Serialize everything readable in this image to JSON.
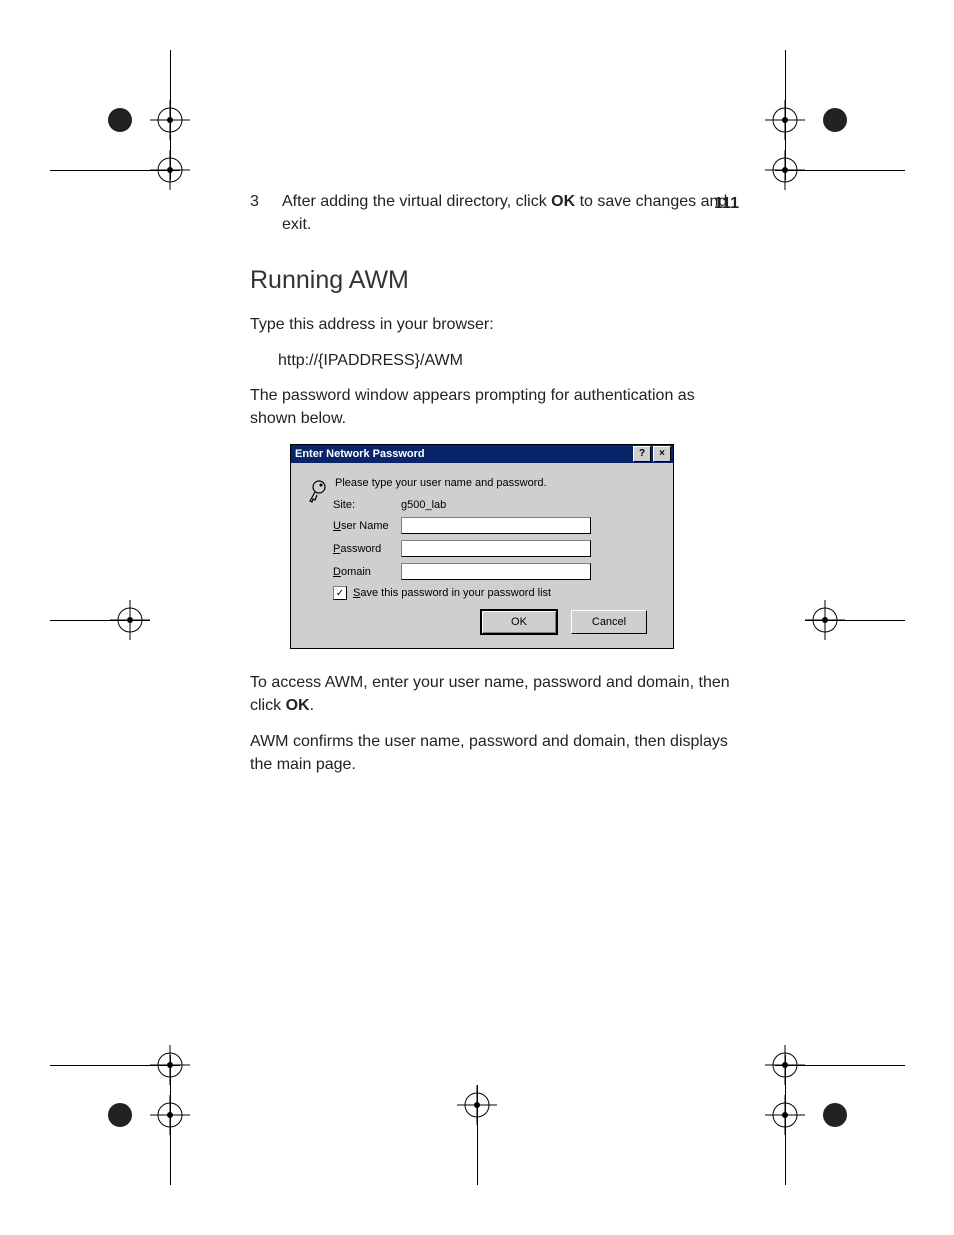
{
  "page_number": "111",
  "step": {
    "num": "3",
    "text_before_bold": "After adding the virtual directory, click ",
    "bold": "OK",
    "text_after_bold": " to save changes and exit."
  },
  "heading": "Running AWM",
  "p1": "Type this address in your browser:",
  "url": "http://{IPADDRESS}/AWM",
  "p2": "The password window appears prompting for authentication as shown below.",
  "dialog": {
    "title": "Enter Network Password",
    "help_glyph": "?",
    "close_glyph": "×",
    "prompt": "Please type your user name and password.",
    "site_label": "Site:",
    "site_value": "g500_lab",
    "user_label_u": "U",
    "user_label_rest": "ser Name",
    "pass_label_u": "P",
    "pass_label_rest": "assword",
    "domain_label_u": "D",
    "domain_label_rest": "omain",
    "check_mark": "✓",
    "save_u": "S",
    "save_rest": "ave this password in your password list",
    "ok": "OK",
    "cancel": "Cancel"
  },
  "p3_before": "To access AWM, enter your user name, password and domain, then click ",
  "p3_bold": "OK",
  "p3_after": ".",
  "p4": "AWM confirms the user name, password and domain, then displays the main page."
}
